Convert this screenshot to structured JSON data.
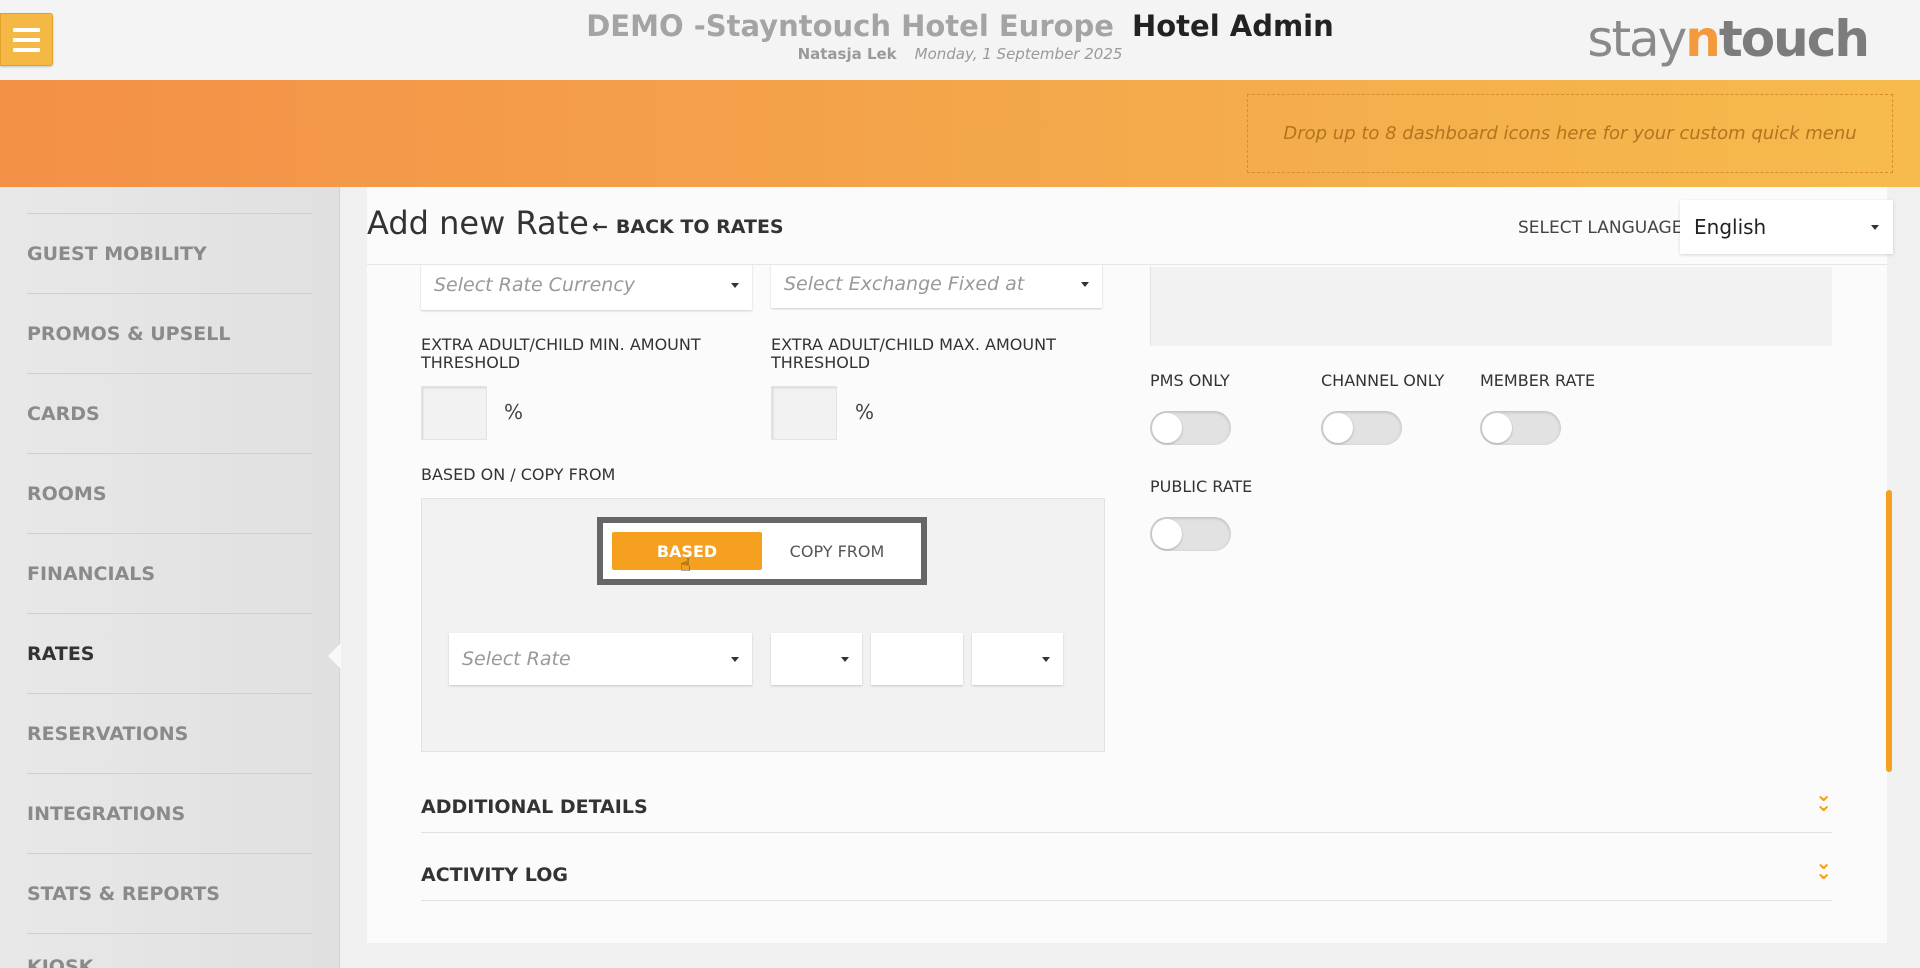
{
  "header": {
    "hotel_name": "DEMO -Stayntouch Hotel Europe",
    "app_name": "Hotel Admin",
    "user": "Natasja Lek",
    "date": "Monday, 1 September 2025",
    "logo_stay": "stay",
    "logo_n": "n",
    "logo_touch": "touch"
  },
  "quick_menu": {
    "placeholder": "Drop up to 8 dashboard icons here for your custom quick menu"
  },
  "sidebar": {
    "items": [
      {
        "label": "GUEST MOBILITY"
      },
      {
        "label": "PROMOS & UPSELL"
      },
      {
        "label": "CARDS"
      },
      {
        "label": "ROOMS"
      },
      {
        "label": "FINANCIALS"
      },
      {
        "label": "RATES",
        "active": true
      },
      {
        "label": "RESERVATIONS"
      },
      {
        "label": "INTEGRATIONS"
      },
      {
        "label": "STATS & REPORTS"
      },
      {
        "label": "KIOSK"
      }
    ]
  },
  "page": {
    "title": "Add new Rate",
    "back_label": "BACK TO RATES",
    "language_label": "SELECT LANGUAGE",
    "language_value": "English"
  },
  "form": {
    "rate_currency_placeholder": "Select Rate Currency",
    "exchange_fixed_placeholder": "Select Exchange Fixed at",
    "min_threshold_label_1": "EXTRA ADULT/CHILD MIN. AMOUNT",
    "min_threshold_label_2": "THRESHOLD",
    "max_threshold_label_1": "EXTRA ADULT/CHILD MAX. AMOUNT",
    "max_threshold_label_2": "THRESHOLD",
    "percent": "%",
    "based_on_label": "BASED ON / COPY FROM",
    "based_button": "BASED",
    "copy_from_button": "COPY FROM",
    "select_rate_placeholder": "Select Rate"
  },
  "toggles": {
    "pms_only": "PMS ONLY",
    "channel_only": "CHANNEL ONLY",
    "member_rate": "MEMBER RATE",
    "public_rate": "PUBLIC RATE"
  },
  "sections": {
    "additional_details": "ADDITIONAL DETAILS",
    "activity_log": "ACTIVITY LOG"
  },
  "colors": {
    "accent": "#f5a01f",
    "orange_start": "#f39048",
    "orange_end": "#f6bb4d"
  }
}
